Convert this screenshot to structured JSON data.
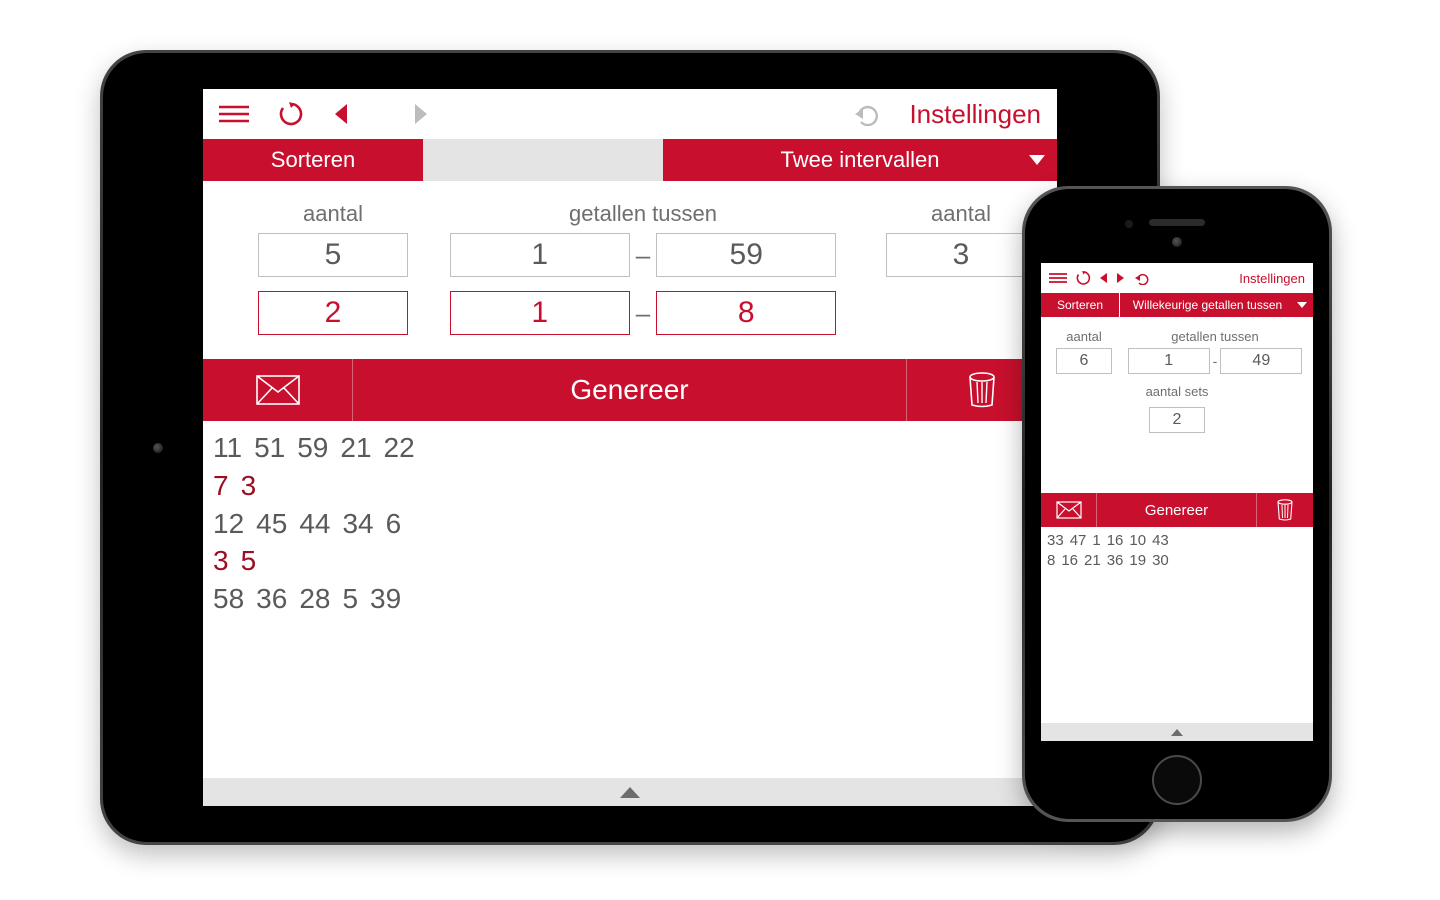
{
  "colors": {
    "accent": "#c8102e"
  },
  "ipad": {
    "topbar": {
      "settings": "Instellingen"
    },
    "tabs": {
      "sort": "Sorteren",
      "mode": "Twee intervallen"
    },
    "labels": {
      "count": "aantal",
      "between": "getallen tussen",
      "count2": "aantal",
      "dash": "–"
    },
    "row1": {
      "count": "5",
      "from": "1",
      "to": "59",
      "count2": "3"
    },
    "row2": {
      "count": "2",
      "from": "1",
      "to": "8"
    },
    "actions": {
      "generate": "Genereer"
    },
    "results": {
      "lines": [
        {
          "color": "grey",
          "nums": [
            "11",
            "51",
            "59",
            "21",
            "22"
          ]
        },
        {
          "color": "red",
          "nums": [
            "7",
            "3"
          ]
        },
        {
          "color": "grey",
          "nums": [
            "12",
            "45",
            "44",
            "34",
            "6"
          ]
        },
        {
          "color": "red",
          "nums": [
            "3",
            "5"
          ]
        },
        {
          "color": "grey",
          "nums": [
            "58",
            "36",
            "28",
            "5",
            "39"
          ]
        }
      ]
    }
  },
  "iphone": {
    "topbar": {
      "settings": "Instellingen"
    },
    "tabs": {
      "sort": "Sorteren",
      "mode": "Willekeurige getallen tussen"
    },
    "labels": {
      "count": "aantal",
      "between": "getallen tussen",
      "sets": "aantal sets",
      "dash": "-"
    },
    "row1": {
      "count": "6",
      "from": "1",
      "to": "49"
    },
    "sets": "2",
    "actions": {
      "generate": "Genereer"
    },
    "results": {
      "lines": [
        {
          "color": "grey",
          "nums": [
            "33",
            "47",
            "1",
            "16",
            "10",
            "43"
          ]
        },
        {
          "color": "grey",
          "nums": [
            "8",
            "16",
            "21",
            "36",
            "19",
            "30"
          ]
        }
      ]
    }
  }
}
